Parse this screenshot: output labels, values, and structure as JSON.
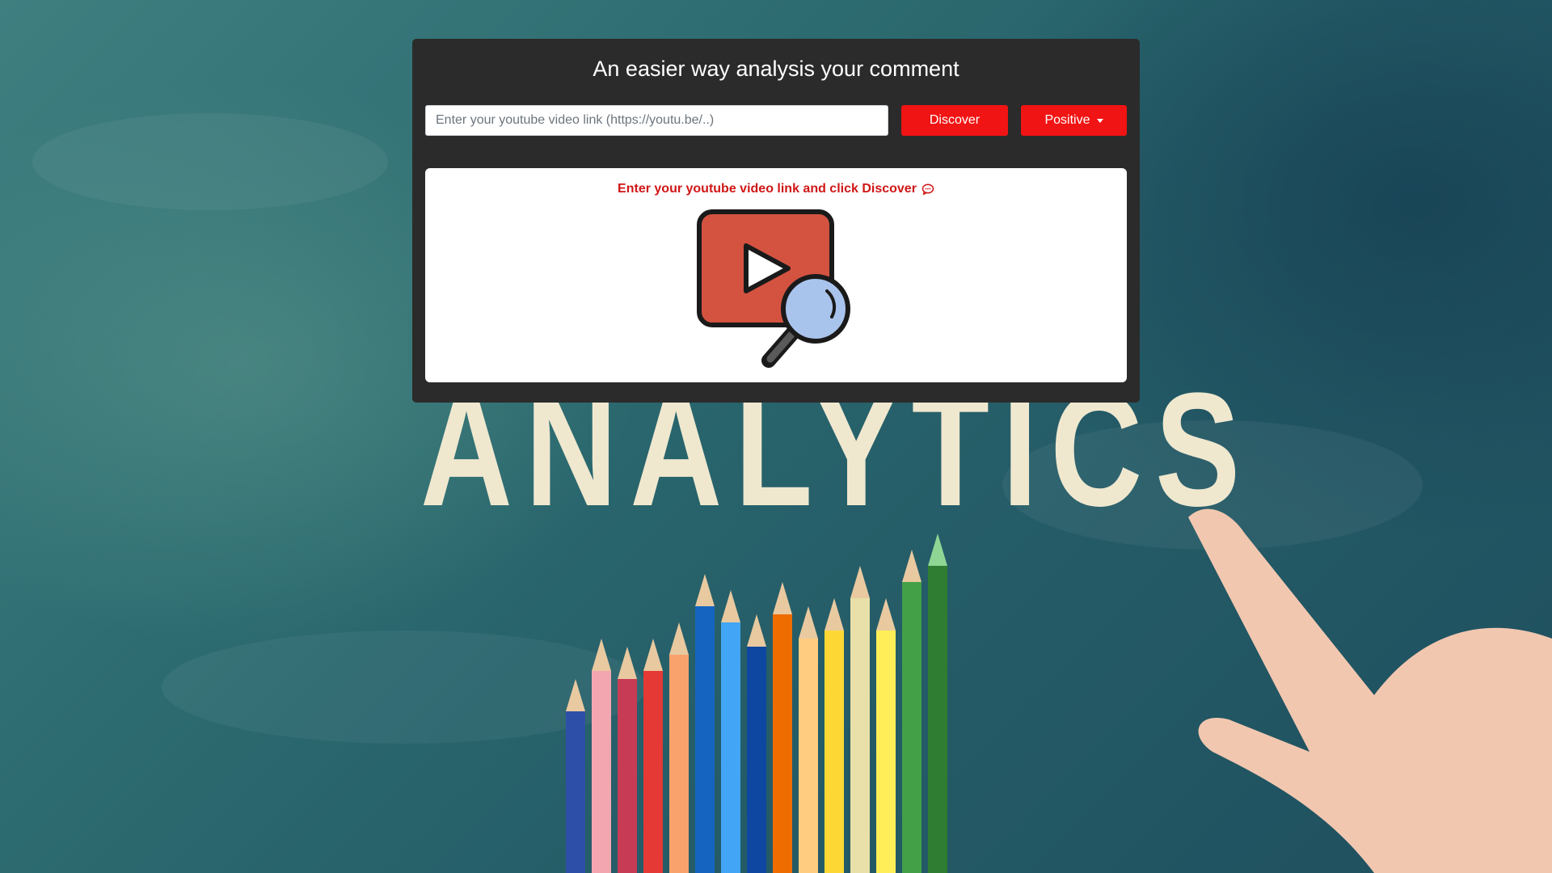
{
  "header": {
    "title": "An easier way analysis your comment"
  },
  "search": {
    "placeholder": "Enter your youtube video link (https://youtu.be/..)",
    "value": ""
  },
  "buttons": {
    "discover_label": "Discover",
    "filter_label": "Positive"
  },
  "result": {
    "hint": "Enter your youtube video link and click Discover",
    "hint_icon": "chat-bubble-icon",
    "illustration_icon": "video-search-icon"
  },
  "background": {
    "word": "ANALYTICS"
  },
  "colors": {
    "accent": "#f01414",
    "hint_text": "#d01616",
    "panel": "#2b2b2b",
    "chalkboard": "#2c6b70"
  }
}
